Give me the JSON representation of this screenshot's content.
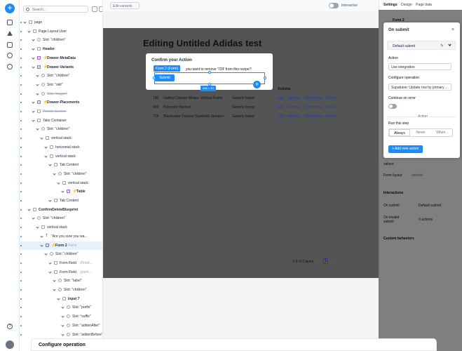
{
  "toolbar": {
    "add_label": "+"
  },
  "search": {
    "placeholder": "Search..."
  },
  "tree": [
    {
      "label": "page",
      "indent": 0,
      "icon": "page"
    },
    {
      "label": "Page Layout User",
      "indent": 1,
      "icon": "page"
    },
    {
      "label": "Slot: \"children\"",
      "indent": 2,
      "icon": "slot"
    },
    {
      "label": "Header",
      "indent": 2,
      "icon": "box",
      "bold": true
    },
    {
      "label": "Drawer-MetaData",
      "indent": 2,
      "icon": "comp",
      "bold": true,
      "bolt": true
    },
    {
      "label": "Drawer-Variants",
      "indent": 2,
      "icon": "comp",
      "bold": true,
      "bolt": true
    },
    {
      "label": "Slot: \"children\"",
      "indent": 3,
      "icon": "slot"
    },
    {
      "label": "Slot: \"skit\"",
      "indent": 3,
      "icon": "slot"
    },
    {
      "label": "Slot: \"trigger\"",
      "indent": 3,
      "icon": "slot",
      "strike": true
    },
    {
      "label": "Drawer-Placements",
      "indent": 2,
      "icon": "comp",
      "bold": true,
      "bolt": true
    },
    {
      "label": "Priority Section",
      "indent": 2,
      "icon": "box",
      "strike": true
    },
    {
      "label": "Tabs Container",
      "indent": 2,
      "icon": "box"
    },
    {
      "label": "Slot: \"children\"",
      "indent": 3,
      "icon": "slot"
    },
    {
      "label": "vertical stack",
      "indent": 4,
      "icon": "box"
    },
    {
      "label": "horizontal stack",
      "indent": 5,
      "icon": "box"
    },
    {
      "label": "vertical stack",
      "indent": 5,
      "icon": "box"
    },
    {
      "label": "Tab Content",
      "indent": 6,
      "icon": "box"
    },
    {
      "label": "Slot: \"children\"",
      "indent": 7,
      "icon": "slot"
    },
    {
      "label": "vertical stack",
      "indent": 8,
      "icon": "box"
    },
    {
      "label": "Table",
      "indent": 9,
      "icon": "comp",
      "bold": true,
      "bolt": true
    },
    {
      "label": "Tab Content",
      "indent": 6,
      "icon": "box"
    },
    {
      "label": "ConfirmDeleteBlueprint",
      "indent": 1,
      "icon": "box",
      "bold": true
    },
    {
      "label": "Slot: \"children\"",
      "indent": 2,
      "icon": "slot"
    },
    {
      "label": "vertical stack",
      "indent": 3,
      "icon": "box"
    },
    {
      "label": "\"Are you sure you wa...",
      "indent": 4,
      "icon": "text"
    },
    {
      "label": "Form 2",
      "indent": 4,
      "icon": "form",
      "bold": true,
      "bolt": true,
      "tag": "Form",
      "selected": true
    },
    {
      "label": "Slot: \"children\"",
      "indent": 5,
      "icon": "slot"
    },
    {
      "label": "Form Field",
      "indent": 6,
      "icon": "box",
      "tag": "(Printf..."
    },
    {
      "label": "Form Field",
      "indent": 6,
      "icon": "box",
      "tag": "(point..."
    },
    {
      "label": "Slot: \"label\"",
      "indent": 7,
      "icon": "slot"
    },
    {
      "label": "Slot: \"children\"",
      "indent": 7,
      "icon": "slot"
    },
    {
      "label": "Input 7",
      "indent": 8,
      "icon": "box",
      "bold": true
    },
    {
      "label": "Slot: \"prefix\"",
      "indent": 9,
      "icon": "slot"
    },
    {
      "label": "Slot: \"suffix\"",
      "indent": 9,
      "icon": "slot"
    },
    {
      "label": "Slot: \"addonAfter\"",
      "indent": 9,
      "icon": "slot"
    },
    {
      "label": "Slot: \"addonBefore\"",
      "indent": 9,
      "icon": "slot"
    }
  ],
  "canvas": {
    "variants_label": "Edit variants",
    "interactive_label": "Interactive",
    "page_title": "Editing Untitled Adidas test",
    "actions_header": "Actions",
    "rows": [
      {
        "id": "190",
        "name": "Gallery Canvas Wraps, Vertical Frame",
        "brand": "Generic brand"
      },
      {
        "id": "409",
        "name": "Polyester Blanket",
        "brand": "Generic brand"
      },
      {
        "id": "729",
        "name": "Blackwater Outdoor Bluetooth Speaker",
        "brand": "Generic brand"
      }
    ],
    "action_links": [
      "Edit",
      "Variants",
      "Placements",
      "Delete"
    ],
    "pager_text": "1-3 of 3 items",
    "pager_page": "1",
    "pager_prev": "‹",
    "pager_next": "›"
  },
  "dialog": {
    "title": "Confirm your Action",
    "text": "you want to remove '729' from this recipe?",
    "form_tag": "Form 2 (Form)",
    "submit_label": "Submit",
    "size_badge": "436 × 40",
    "plus_label": "+"
  },
  "right_panel": {
    "tabs": [
      "Settings",
      "Design",
      "Page data"
    ],
    "selected_title": "Form 2",
    "under_rows": [
      {
        "label": "values",
        "value": ""
      },
      {
        "label": "Form layout",
        "value": "vertical"
      },
      {
        "label": "Interactions",
        "value": ""
      },
      {
        "label": "On submit",
        "value": "Default submit"
      },
      {
        "label": "On invalid submit",
        "value": "0 actions"
      },
      {
        "label": "Custom behaviors",
        "value": ""
      }
    ]
  },
  "popover": {
    "title": "On submit",
    "close_label": "×",
    "default_submit": "Default submit",
    "action_label": "Action",
    "action_value": "Use integration",
    "operation_label": "Configure operation",
    "operation_value": "Supabase: Update row by primary ...",
    "continue_label": "Continue on error",
    "section_label": "Action",
    "run_label": "Run this step",
    "run_options": [
      "Always",
      "Never",
      "When..."
    ],
    "add_label": "+ Add new action"
  },
  "drawer": {
    "title": "Configure operation"
  }
}
